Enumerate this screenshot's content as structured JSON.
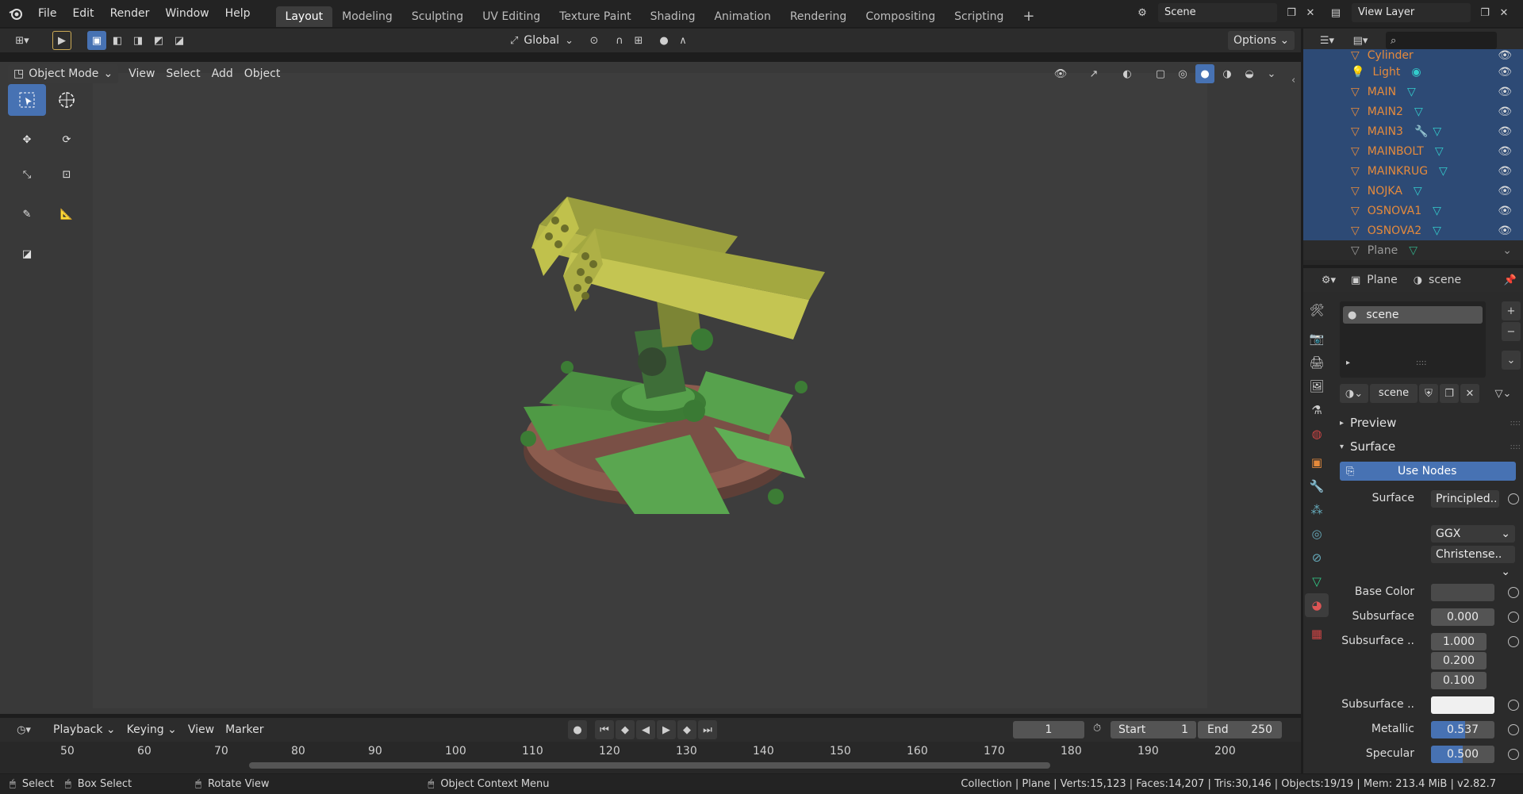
{
  "top_menu": {
    "items": [
      "File",
      "Edit",
      "Render",
      "Window",
      "Help"
    ],
    "workspaces": [
      "Layout",
      "Modeling",
      "Sculpting",
      "UV Editing",
      "Texture Paint",
      "Shading",
      "Animation",
      "Rendering",
      "Compositing",
      "Scripting"
    ],
    "active_workspace": "Layout",
    "scene_name": "Scene",
    "view_layer": "View Layer"
  },
  "viewport_header": {
    "transform_orientation": "Global",
    "options": "Options",
    "mode": "Object Mode",
    "menus": [
      "View",
      "Select",
      "Add",
      "Object"
    ]
  },
  "outliner": {
    "rows": [
      {
        "name": "Cylinder"
      },
      {
        "name": "Light"
      },
      {
        "name": "MAIN"
      },
      {
        "name": "MAIN2"
      },
      {
        "name": "MAIN3"
      },
      {
        "name": "MAINBOLT"
      },
      {
        "name": "MAINKRUG"
      },
      {
        "name": "NOJKA"
      },
      {
        "name": "OSNOVA1"
      },
      {
        "name": "OSNOVA2"
      },
      {
        "name": "Plane"
      }
    ]
  },
  "properties": {
    "object_name": "Plane",
    "material_context": "scene",
    "slot_name": "scene",
    "material_name": "scene",
    "panels": {
      "preview": "Preview",
      "surface": "Surface"
    },
    "use_nodes": "Use Nodes",
    "surface_label": "Surface",
    "surface_value": "Principled..",
    "distribution": "GGX",
    "subsurface_method": "Christense..",
    "fields": [
      {
        "label": "Base Color",
        "value": ""
      },
      {
        "label": "Subsurface",
        "value": "0.000"
      },
      {
        "label": "Subsurface ..",
        "value": "1.000"
      },
      {
        "label": "",
        "value": "0.200"
      },
      {
        "label": "",
        "value": "0.100"
      },
      {
        "label": "Subsurface ..",
        "value": ""
      },
      {
        "label": "Metallic",
        "value": "0.537",
        "fill": 0.537
      },
      {
        "label": "Specular",
        "value": "0.500",
        "fill": 0.5
      }
    ]
  },
  "timeline": {
    "menus": [
      "Playback",
      "Keying",
      "View",
      "Marker"
    ],
    "current_frame": "1",
    "start_label": "Start",
    "start": "1",
    "end_label": "End",
    "end": "250",
    "ruler": [
      "50",
      "60",
      "70",
      "80",
      "90",
      "100",
      "110",
      "120",
      "130",
      "140",
      "150",
      "160",
      "170",
      "180",
      "190",
      "200"
    ]
  },
  "statusbar": {
    "select": "Select",
    "box_select": "Box Select",
    "rotate_view": "Rotate View",
    "context_menu": "Object Context Menu",
    "stats": "Collection | Plane | Verts:15,123 | Faces:14,207 | Tris:30,146 | Objects:19/19 | Mem: 213.4 MiB | v2.82.7"
  },
  "colors": {
    "accent": "#4772b3",
    "object_name": "#e58a3c",
    "selected_row": "#2d4a75"
  }
}
